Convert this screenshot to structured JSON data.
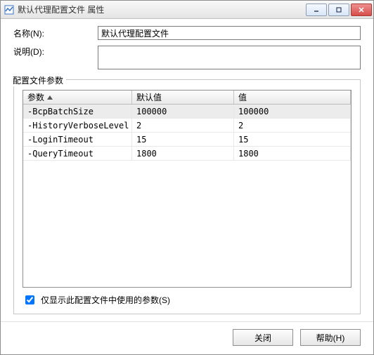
{
  "window": {
    "title": "默认代理配置文件 属性"
  },
  "form": {
    "name_label": "名称(N):",
    "name_value": "默认代理配置文件",
    "desc_label": "说明(D):",
    "desc_value": ""
  },
  "fieldset": {
    "legend": "配置文件参数"
  },
  "table": {
    "headers": {
      "param": "参数",
      "default": "默认值",
      "value": "值"
    },
    "rows": [
      {
        "param": "-BcpBatchSize",
        "default": "100000",
        "value": "100000",
        "selected": true
      },
      {
        "param": "-HistoryVerboseLevel",
        "default": "2",
        "value": "2",
        "selected": false
      },
      {
        "param": "-LoginTimeout",
        "default": "15",
        "value": "15",
        "selected": false
      },
      {
        "param": "-QueryTimeout",
        "default": "1800",
        "value": "1800",
        "selected": false
      }
    ]
  },
  "checkbox": {
    "label": "仅显示此配置文件中使用的参数(S)",
    "checked": true
  },
  "buttons": {
    "close": "关闭",
    "help": "帮助(H)"
  }
}
